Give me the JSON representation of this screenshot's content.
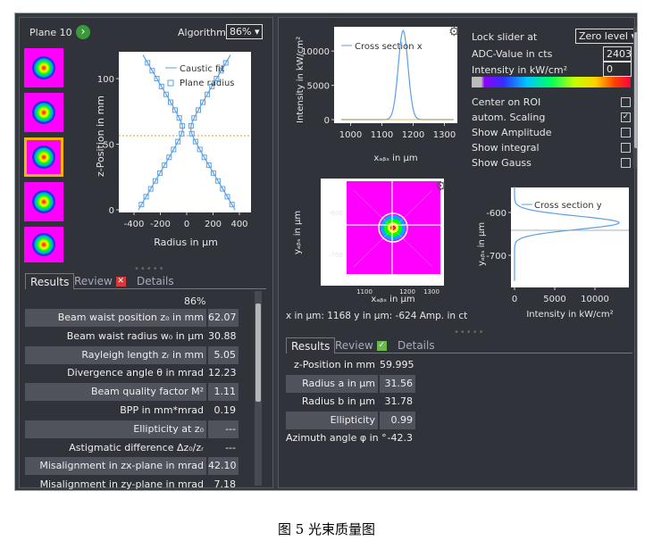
{
  "left": {
    "plane_label": "Plane 10",
    "algorithm_label": "Algorithm",
    "algorithm_value": "86%",
    "caustic": {
      "legend": [
        "Caustic fit",
        "Plane radius"
      ],
      "ylabel": "z-Position in mm",
      "xlabel": "Radius in µm",
      "xticks": [
        "-400",
        "-200",
        "0",
        "200",
        "400"
      ],
      "yticks": [
        "100",
        "50",
        "0"
      ]
    },
    "tabs": {
      "results": "Results",
      "review": "Review",
      "details": "Details"
    },
    "table_header": "86%",
    "rows": [
      {
        "label": "Beam waist position z₀ in mm",
        "value": "62.07"
      },
      {
        "label": "Beam waist radius w₀ in µm",
        "value": "30.88"
      },
      {
        "label": "Rayleigh length zᵣ in mm",
        "value": "5.05"
      },
      {
        "label": "Divergence angle θ in mrad",
        "value": "12.23"
      },
      {
        "label": "Beam quality factor M²",
        "value": "1.11"
      },
      {
        "label": "BPP in mm*mrad",
        "value": "0.19"
      },
      {
        "label": "Ellipticity at z₀",
        "value": "---"
      },
      {
        "label": "Astigmatic difference Δz₀/zᵣ",
        "value": "---"
      },
      {
        "label": "Misalignment in zx-plane in mrad",
        "value": "42.10"
      },
      {
        "label": "Misalignment in zy-plane in mrad",
        "value": "7.18"
      }
    ]
  },
  "right": {
    "cross_x": {
      "legend": "Cross section x",
      "ylabel": "Intensity in kW/cm²",
      "xlabel": "xₐᵦₛ in µm",
      "yticks": [
        "10000",
        "5000",
        "0"
      ],
      "xticks": [
        "1000",
        "1100",
        "1200",
        "1300"
      ]
    },
    "lock_label": "Lock slider at",
    "lock_value": "Zero level",
    "adc_label": "ADC-Value in cts",
    "adc_value": "2403",
    "intensity_label": "Intensity in kW/cm²",
    "intensity_value": "0",
    "options": [
      {
        "label": "Center on ROI",
        "checked": false
      },
      {
        "label": "autom. Scaling",
        "checked": true
      },
      {
        "label": "Show Amplitude",
        "checked": false
      },
      {
        "label": "Show integral",
        "checked": false
      },
      {
        "label": "Show Gauss",
        "checked": false
      }
    ],
    "image2d": {
      "ylabel": "yₐᵦₛ in µm",
      "xlabel": "xₐᵦₛ in µm",
      "yticks": [
        "-600",
        "-700"
      ],
      "xticks": [
        "1100",
        "1200",
        "1300"
      ]
    },
    "cross_y": {
      "legend": "Cross section y",
      "ylabel": "yₐᵦₛ in µm",
      "xlabel": "Intensity in kW/cm²",
      "yticks": [
        "-600",
        "-700"
      ],
      "xticks": [
        "0",
        "5000",
        "10000"
      ]
    },
    "readout": "x in µm:  1168  y in µm:  -624  Amp. in ct",
    "tabs": {
      "results": "Results",
      "review": "Review",
      "details": "Details"
    },
    "rows": [
      {
        "label": "z-Position in mm",
        "value": "59.995"
      },
      {
        "label": "Radius a in µm",
        "value": "31.56"
      },
      {
        "label": "Radius b in µm",
        "value": "31.78"
      },
      {
        "label": "Ellipticity",
        "value": "0.99"
      },
      {
        "label": "Azimuth angle φ in °",
        "value": "-42.3"
      }
    ]
  },
  "caption": "图 5  光束质量图",
  "colors": {
    "accent": "#f4b400",
    "line": "#5aa0e6",
    "review_left": "#d43b3b",
    "review_right": "#6bb84a"
  }
}
